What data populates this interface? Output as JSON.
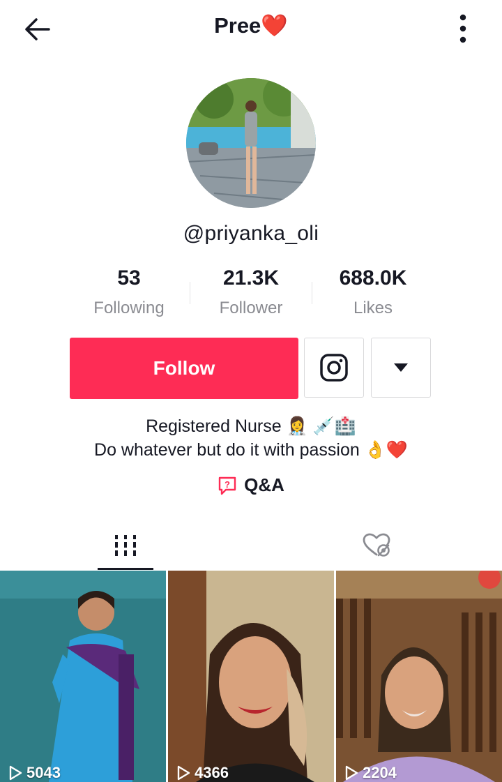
{
  "header": {
    "title": "Pree❤️"
  },
  "profile": {
    "handle": "@priyanka_oli"
  },
  "stats": [
    {
      "value": "53",
      "label": "Following"
    },
    {
      "value": "21.3K",
      "label": "Follower"
    },
    {
      "value": "688.0K",
      "label": "Likes"
    }
  ],
  "actions": {
    "follow_label": "Follow"
  },
  "bio": {
    "line1": "Registered Nurse 👩‍⚕️ 💉🏥",
    "line2": "Do whatever but do it with passion 👌❤️"
  },
  "qa": {
    "label": "Q&A"
  },
  "videos": [
    {
      "plays": "5043"
    },
    {
      "plays": "4366"
    },
    {
      "plays": "2204"
    }
  ],
  "colors": {
    "accent": "#fe2c55",
    "text": "#161823",
    "muted": "#8a8b91"
  }
}
